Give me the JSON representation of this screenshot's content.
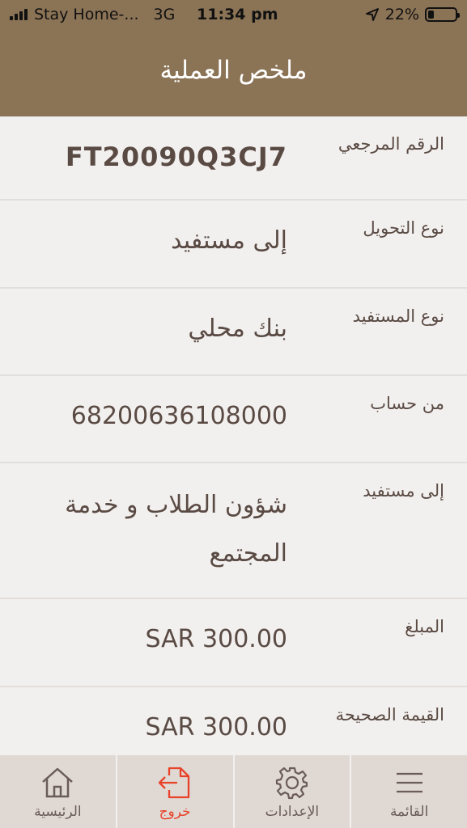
{
  "status_bar": {
    "carrier": "Stay Home-...",
    "network": "3G",
    "time": "11:34 pm",
    "battery": "22%",
    "battery_level": 0.22
  },
  "header": {
    "title": "ملخص العملية"
  },
  "rows": [
    {
      "label": "الرقم المرجعي",
      "value": "FT20090Q3CJ7"
    },
    {
      "label": "نوع التحويل",
      "value": "إلى مستفيد"
    },
    {
      "label": "نوع المستفيد",
      "value": "بنك محلي"
    },
    {
      "label": "من حساب",
      "value": "68200636108000"
    },
    {
      "label": "إلى مستفيد",
      "value": "شؤون الطلاب و خدمة المجتمع"
    },
    {
      "label": "المبلغ",
      "value": "SAR 300.00"
    },
    {
      "label": "القيمة الصحيحة",
      "value": "SAR 300.00"
    }
  ],
  "tabbar": {
    "home": "الرئيسية",
    "logout": "خروج",
    "settings": "الإعدادات",
    "menu": "القائمة"
  },
  "colors": {
    "header_bg": "#8b7356",
    "active_tab": "#e8432a",
    "tab_text": "#6a5c57",
    "tabbar_bg": "#e0d8d3"
  }
}
